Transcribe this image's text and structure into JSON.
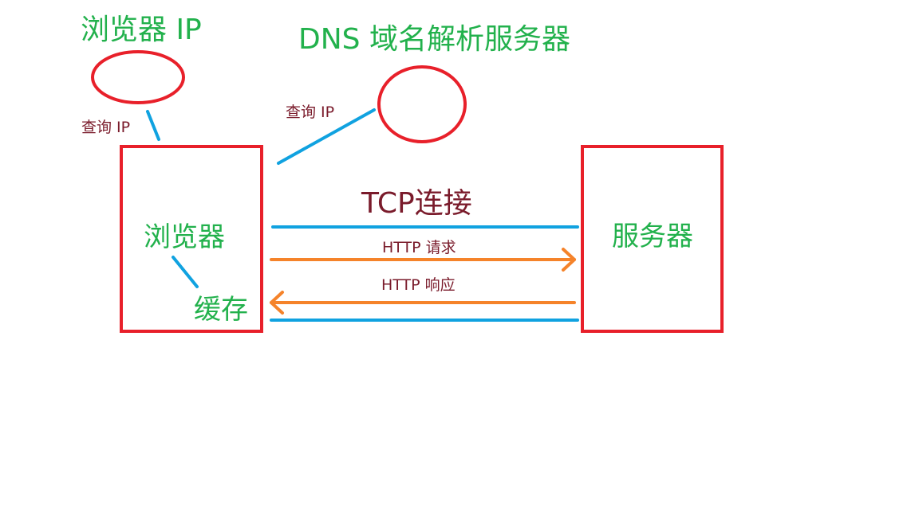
{
  "labels": {
    "browser_ip": "浏览器 IP",
    "dns_server": "DNS 域名解析服务器",
    "query_ip_left": "查询 IP",
    "query_ip_mid": "查询 IP",
    "browser": "浏览器",
    "cache": "缓存",
    "server": "服务器",
    "tcp_connect": "TCP连接",
    "http_request": "HTTP 请求",
    "http_response": "HTTP 响应"
  },
  "colors": {
    "box": "#e8202a",
    "blue_line": "#10a2e0",
    "orange_arrow": "#f5832a",
    "green_text": "#22b14c",
    "maroon_text": "#7a1b2b"
  }
}
